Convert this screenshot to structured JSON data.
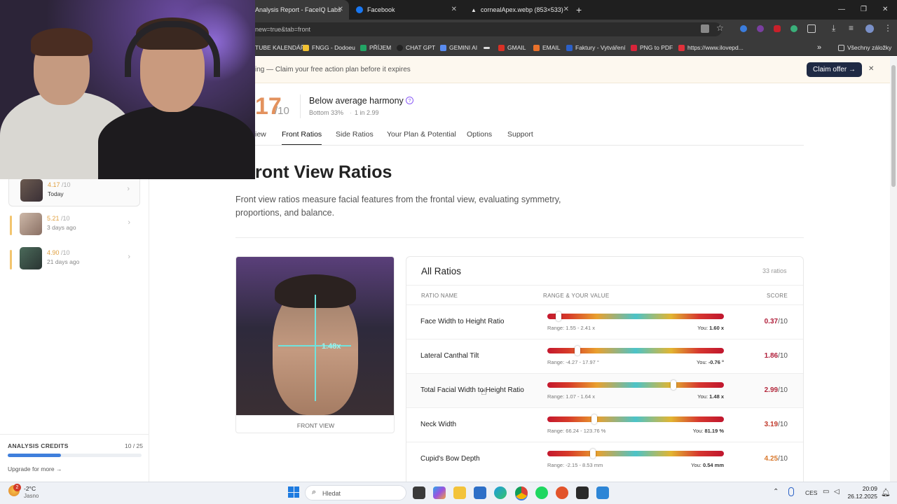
{
  "browser": {
    "tabs": [
      {
        "label": "Analysis Report - FaceIQ Labs",
        "active": true
      },
      {
        "label": "Facebook",
        "active": false
      },
      {
        "label": "cornealApex.webp (853×533)",
        "active": false
      }
    ],
    "new_tab": "+",
    "window_controls": [
      "—",
      "❐",
      "✕"
    ],
    "url": "new=true&tab=front",
    "bookmarks": [
      {
        "label": "TUBE KALENDÁŘ",
        "color": "#cfcfcf"
      },
      {
        "label": "FNGG - Dodoeu",
        "color": "#f2c233"
      },
      {
        "label": "PŘÍJEM",
        "color": "#22a565"
      },
      {
        "label": "CHAT GPT",
        "color": "#222222"
      },
      {
        "label": "GEMINI AI",
        "color": "#5a8cf0"
      },
      {
        "label": "",
        "color": "#444444"
      },
      {
        "label": "GMAIL",
        "color": "#d93025"
      },
      {
        "label": "EMAIL",
        "color": "#e8712b"
      },
      {
        "label": "Faktury - Vytváření",
        "color": "#2b60c8"
      },
      {
        "label": "PNG to PDF",
        "color": "#d8243a"
      },
      {
        "label": "https://www.ilovepd...",
        "color": "#e0303a"
      }
    ],
    "bookmarks_more": "»",
    "all_bookmarks": "Všechny záložky"
  },
  "banner": {
    "text": "ing — Claim your free action plan before it expires",
    "button": "Claim offer →",
    "close": "✕"
  },
  "header": {
    "score": "17",
    "score_total": "/10",
    "rating": "Below average harmony",
    "info_icon": "?",
    "percentile": "Bottom 33%",
    "odds": "1 in 2.99"
  },
  "nav": {
    "tabs": [
      "iew",
      "Front Ratios",
      "Side Ratios",
      "Your Plan & Potential",
      "Options",
      "Support"
    ],
    "active_index": 1
  },
  "page": {
    "title": "ront View Ratios",
    "description": "Front view ratios measure facial features from the frontal view, evaluating symmetry, proportions, and balance."
  },
  "sidebar": {
    "history": [
      {
        "score": "4.17",
        "total": "/10",
        "date": "Today",
        "selected": true
      },
      {
        "score": "5.21",
        "total": "/10",
        "date": "3 days ago",
        "selected": false
      },
      {
        "score": "4.90",
        "total": "/10",
        "date": "21 days ago",
        "selected": false
      }
    ],
    "credits_label": "ANALYSIS CREDITS",
    "credits_value": "10 / 25",
    "credits_fraction": 0.4,
    "upgrade": "Upgrade for more →"
  },
  "photo": {
    "overlay_value": "1.48x",
    "caption": "FRONT VIEW"
  },
  "ratios": {
    "title": "All Ratios",
    "count": "33 ratios",
    "headers": [
      "RATIO NAME",
      "RANGE & YOUR VALUE",
      "SCORE"
    ],
    "rows": [
      {
        "name": "Face Width to Height Ratio",
        "range": "Range: 1.55 - 2.41 x",
        "you_label": "You:",
        "you_value": "1.60 x",
        "score": "0.37",
        "total": "/10",
        "position": 0.05
      },
      {
        "name": "Lateral Canthal Tilt",
        "range": "Range: -4.27 - 17.97 °",
        "you_label": "You:",
        "you_value": "-0.76 °",
        "score": "1.86",
        "total": "/10",
        "position": 0.16
      },
      {
        "name": "Total Facial Width to Height Ratio",
        "range": "Range: 1.07 - 1.64 x",
        "you_label": "You:",
        "you_value": "1.48 x",
        "score": "2.99",
        "total": "/10",
        "position": 0.72
      },
      {
        "name": "Neck Width",
        "range": "Range: 66.24 - 123.76 %",
        "you_label": "You:",
        "you_value": "81.19 %",
        "score": "3.19",
        "total": "/10",
        "position": 0.26
      },
      {
        "name": "Cupid's Bow Depth",
        "range": "Range: -2.15 - 8.53 mm",
        "you_label": "You:",
        "you_value": "0.54 mm",
        "score": "4.25",
        "total": "/10",
        "position": 0.25
      }
    ]
  },
  "taskbar": {
    "weather_temp": "-2°C",
    "weather_text": "Jasno",
    "search_placeholder": "Hledat",
    "lang": "CES",
    "time": "20:09",
    "date": "26.12.2025",
    "badge": "2"
  }
}
